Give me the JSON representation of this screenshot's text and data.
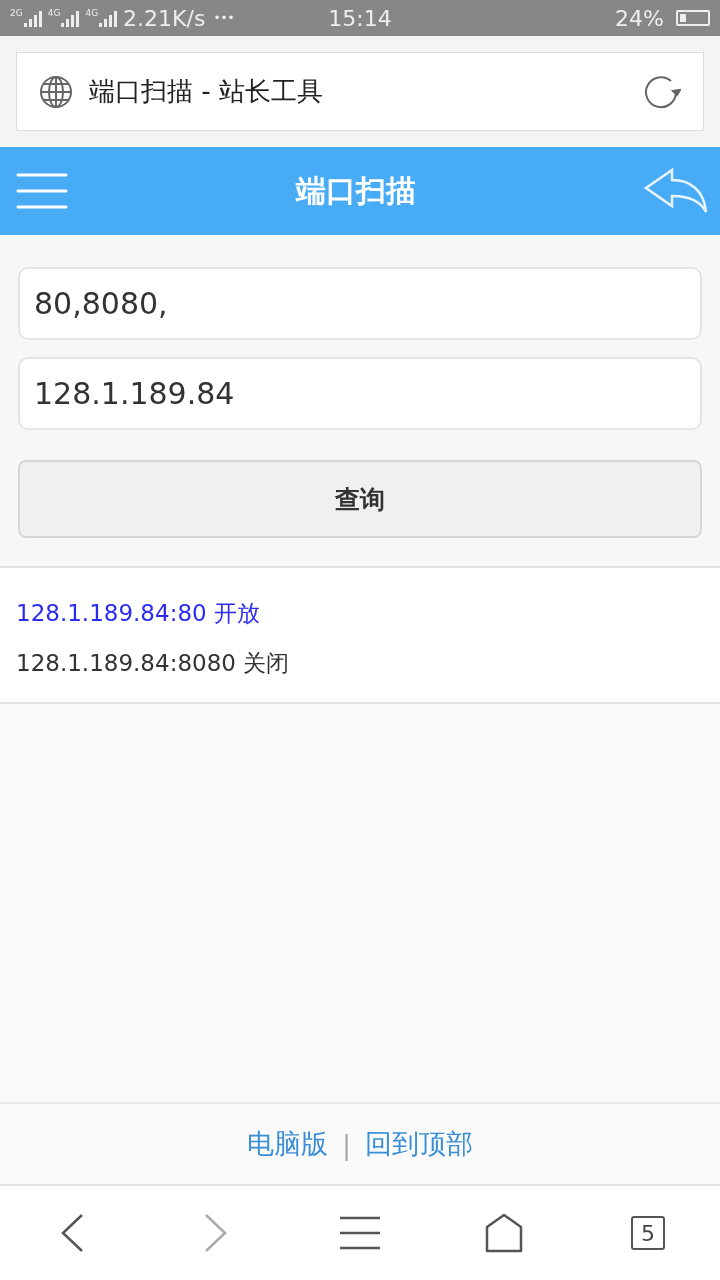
{
  "status_bar": {
    "signal_labels": [
      "2G",
      "4G",
      "4G"
    ],
    "speed": "2.21K/s",
    "more": "•••",
    "time": "15:14",
    "battery": "24%"
  },
  "address_bar": {
    "title": "端口扫描 - 站长工具"
  },
  "header": {
    "title": "端口扫描"
  },
  "form": {
    "fields": [
      {
        "value": "80,8080,"
      },
      {
        "value": "128.1.189.84"
      }
    ],
    "button": "查询"
  },
  "results": [
    {
      "kind": "open",
      "text": "128.1.189.84:80 开放"
    },
    {
      "kind": "closed",
      "text": "128.1.189.84:8080 关闭"
    }
  ],
  "footer": {
    "links": [
      "电脑版",
      "回到顶部"
    ],
    "separator": "|"
  },
  "nav_bar": {
    "items": [
      {
        "kind": "back",
        "disabled": false
      },
      {
        "kind": "forward",
        "disabled": true
      },
      {
        "kind": "menu",
        "disabled": false
      },
      {
        "kind": "home",
        "disabled": false
      },
      {
        "kind": "tabs",
        "disabled": false,
        "count": "5"
      }
    ]
  }
}
